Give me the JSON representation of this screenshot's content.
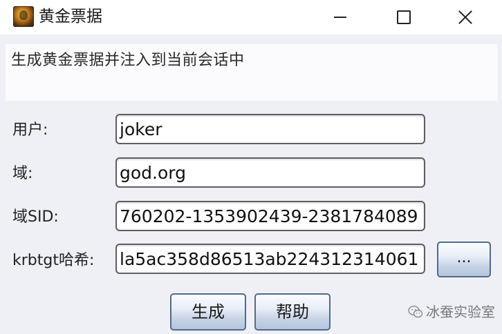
{
  "window": {
    "title": "黄金票据",
    "icon": "golden-ticket-app-icon",
    "controls": {
      "minimize_icon": "minimize-icon",
      "maximize_icon": "maximize-icon",
      "close_icon": "close-icon"
    }
  },
  "description": "生成黄金票据并注入到当前会话中",
  "form": {
    "user": {
      "label": "用户:",
      "value": "joker"
    },
    "domain": {
      "label": "域:",
      "value": "god.org"
    },
    "domain_sid": {
      "label": "域SID:",
      "value": "760202-1353902439-2381784089"
    },
    "krbtgt_hash": {
      "label": "krbtgt哈希:",
      "value": "la5ac358d86513ab224312314061"
    },
    "browse_button": "..."
  },
  "buttons": {
    "generate": "生成",
    "help": "帮助"
  },
  "watermark": {
    "icon": "wechat-icon",
    "text": "冰蚕实验室"
  },
  "colors": {
    "window_bg": "#eef0f5",
    "button_border": "#506a8c",
    "field_border": "#5e5e5e"
  }
}
